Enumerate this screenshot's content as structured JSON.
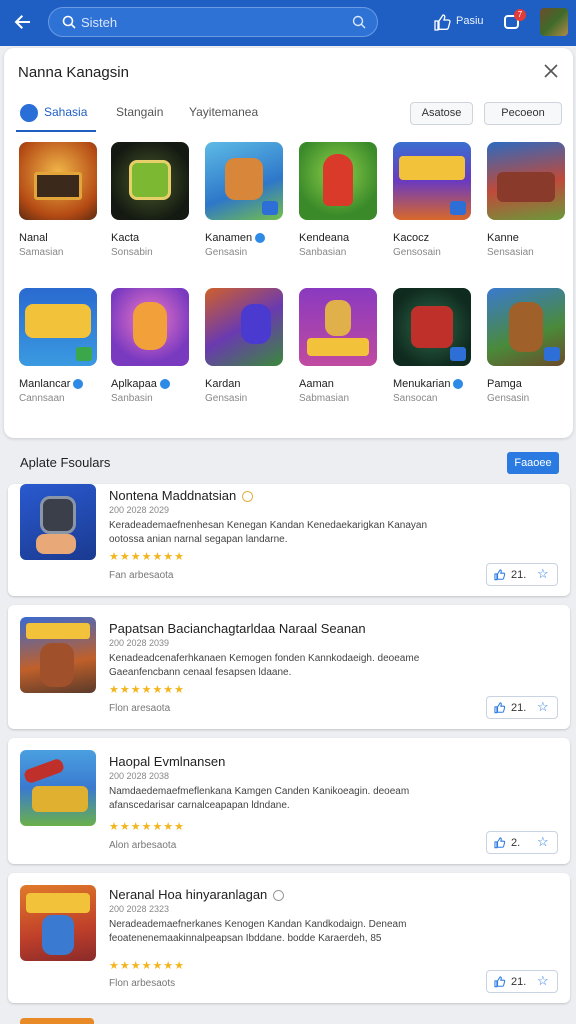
{
  "topbar": {
    "search_text": "Sisteh",
    "label": "Pasiu",
    "notif_count": "7",
    "colors": {
      "bar": "#1f5fc4"
    }
  },
  "panel": {
    "title": "Nanna Kanagsin",
    "tabs": [
      "Sahasia",
      "Stangain",
      "Yayitemanea"
    ],
    "chips": [
      "Asatose",
      "Pecoeon"
    ],
    "apps": [
      {
        "name": "Nanal",
        "sub": "Samasian",
        "verified": false,
        "icon": "bus-game-icon"
      },
      {
        "name": "Kacta",
        "sub": "Sonsabin",
        "verified": false,
        "icon": "robot-game-icon"
      },
      {
        "name": "Kanamen",
        "sub": "Gensasin",
        "verified": true,
        "icon": "hero-game-icon"
      },
      {
        "name": "Kendeana",
        "sub": "Sanbasian",
        "verified": false,
        "icon": "warrior-game-icon"
      },
      {
        "name": "Kacocz",
        "sub": "Gensosain",
        "verified": false,
        "icon": "puzzle-game-icon"
      },
      {
        "name": "Kanne",
        "sub": "Sensasian",
        "verified": false,
        "icon": "army-game-icon"
      },
      {
        "name": "Manlancar",
        "sub": "Cannsaan",
        "verified": true,
        "icon": "bubbles-game-icon"
      },
      {
        "name": "Aplkapaa",
        "sub": "Sanbasin",
        "verified": true,
        "icon": "explorer-game-icon"
      },
      {
        "name": "Kardan",
        "sub": "Gensasin",
        "verified": false,
        "icon": "battle-game-icon"
      },
      {
        "name": "Aaman",
        "sub": "Sabmasian",
        "verified": false,
        "icon": "farmer-game-icon"
      },
      {
        "name": "Menukarian",
        "sub": "Sansocan",
        "verified": true,
        "icon": "machine-game-icon"
      },
      {
        "name": "Pamga",
        "sub": "Gensasin",
        "verified": false,
        "icon": "soldier-game-icon"
      }
    ]
  },
  "section": {
    "title": "Aplate Fsoulars",
    "button": "Faaoee"
  },
  "cards": [
    {
      "title": "Nontena Maddnatsian",
      "meta": "200 2028 2029",
      "desc": "Keradeademaefnenhesan Kenegan Kandan Kenedaekarigkan Kanayan ootossa anian narnal segapan landarne.",
      "stars": "★★★★★★★",
      "footer": "Fan arbesaota",
      "count": "21.",
      "icon": "robot-arm-icon"
    },
    {
      "title": "Papatsan Bacianchagtarldaa Naraal Seanan",
      "meta": "200 2028 2039",
      "desc": "Kenadeadcenaferhkanaen Kemogen fonden Kannkodaeigh. deoeame Gaeanfencbann cenaal fesapsen ldaane.",
      "stars": "★★★★★★★",
      "footer": "Flon aresaota",
      "count": "21.",
      "icon": "ogre-game-icon"
    },
    {
      "title": "Haopal Evmlnansen",
      "meta": "200 2028 2038",
      "desc": "Namdaedemaefmeflenkana Kamgen Canden Kanikoeagin. deoeam afanscedarisar carnalceapapan ldndane.",
      "stars": "★★★★★★★",
      "footer": "Alon arbesaota",
      "count": "2.",
      "icon": "cannon-game-icon"
    },
    {
      "title": "Neranal Hoa hinyaranlagan",
      "meta": "200 2028 2323",
      "desc": "Neradeademaefnerkanes Kenogen Kandan Kandkodaign. Deneam feoatenenemaakinnalpeapsan Ibddane. bodde Karaerdeh, 85",
      "stars": "★★★★★★★",
      "footer": "Flon arbesaots",
      "count": "21.",
      "icon": "adventure-game-icon"
    }
  ]
}
